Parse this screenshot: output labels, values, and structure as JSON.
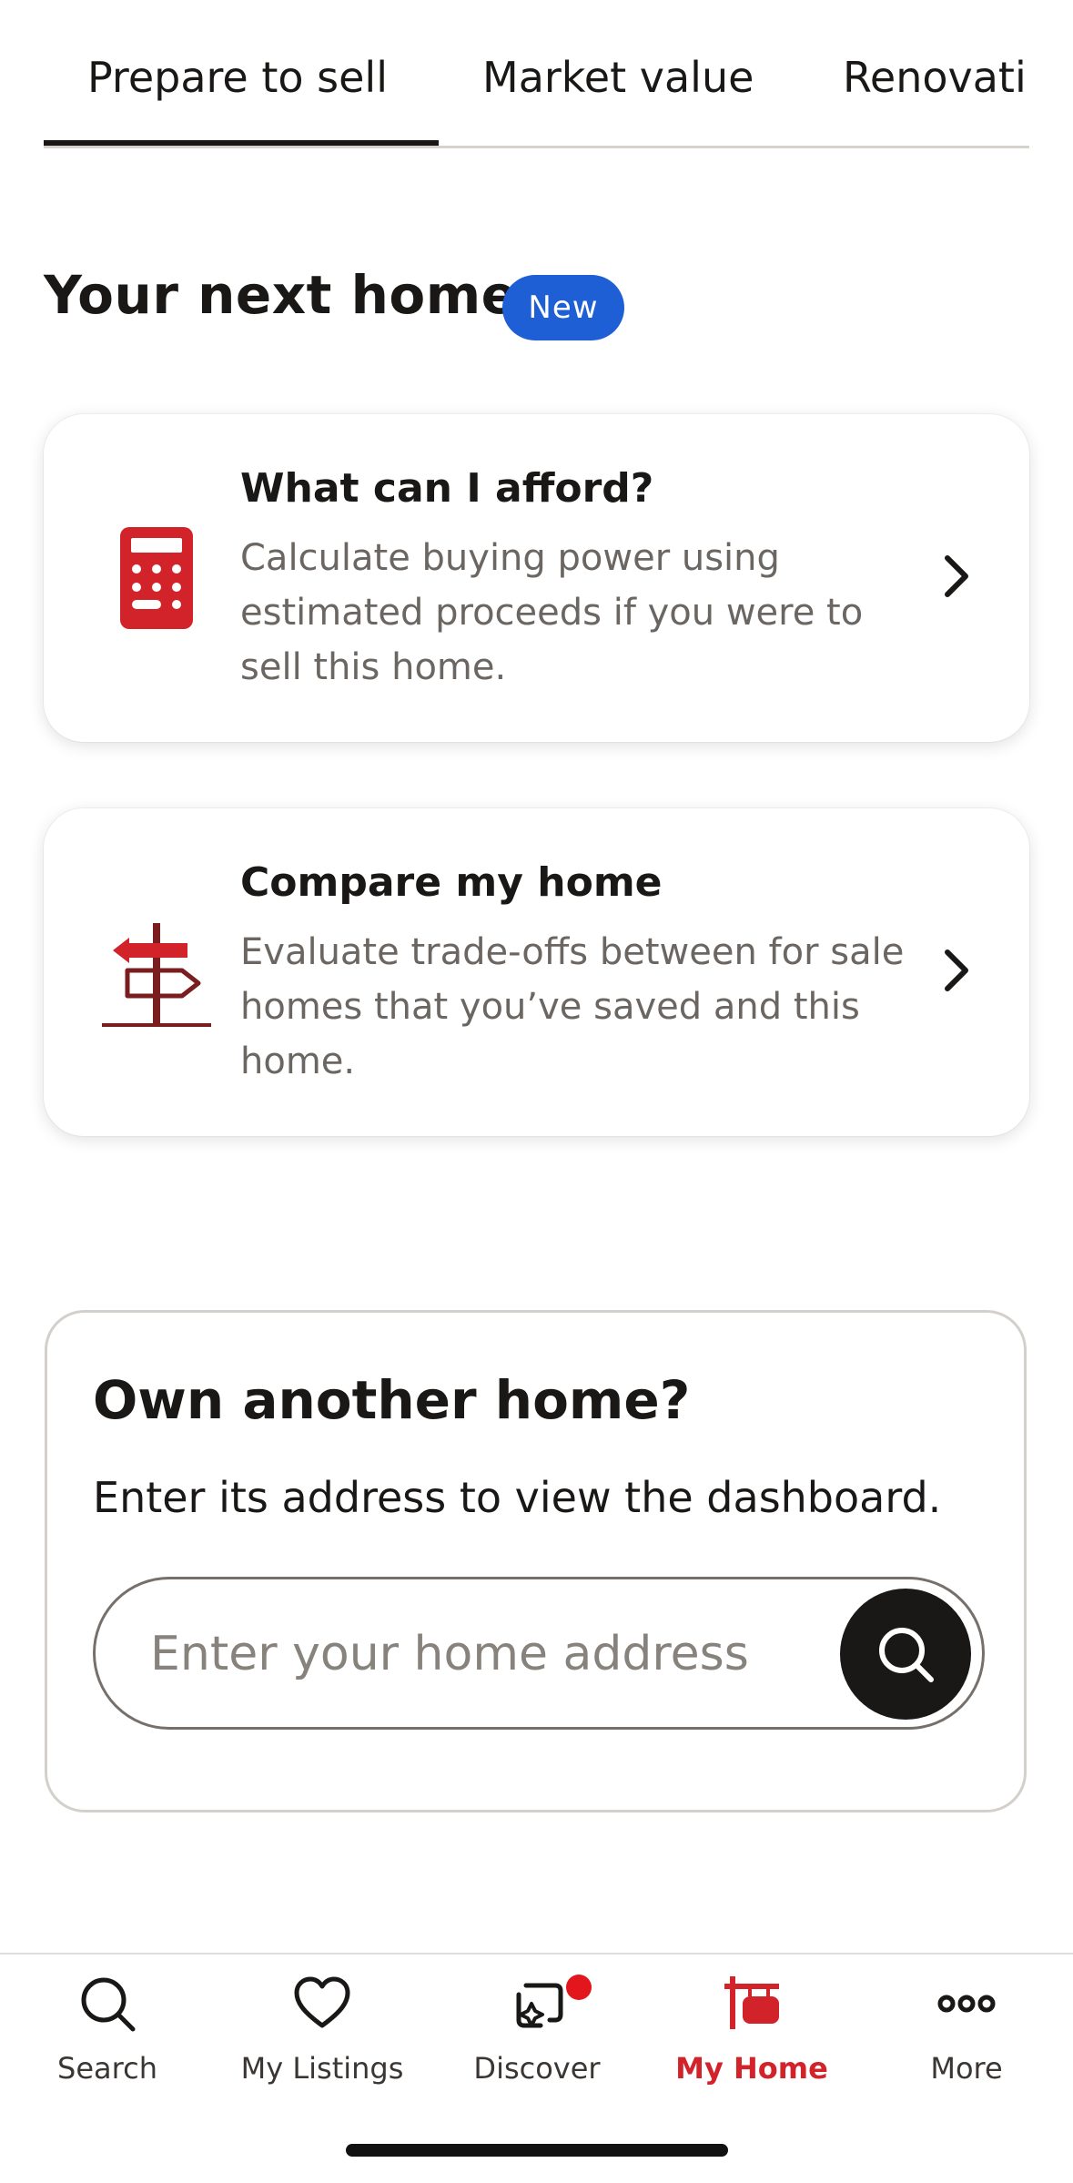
{
  "tabs": {
    "items": [
      "Prepare to sell",
      "Market value",
      "Renovati"
    ],
    "active_index": 0
  },
  "section": {
    "title": "Your next home",
    "badge": "New"
  },
  "cards": [
    {
      "title": "What can I afford?",
      "description": "Calculate buying power using estimated proceeds if you were to sell this home.",
      "icon": "calculator-icon"
    },
    {
      "title": "Compare my home",
      "description": "Evaluate trade-offs between for sale homes that you’ve saved and this home.",
      "icon": "signpost-icon"
    }
  ],
  "own_home": {
    "title": "Own another home?",
    "description": "Enter its address to view the dashboard.",
    "input_value": "",
    "input_placeholder": "Enter your home address"
  },
  "bottom_nav": {
    "items": [
      {
        "label": "Search",
        "icon": "search-icon"
      },
      {
        "label": "My Listings",
        "icon": "heart-icon"
      },
      {
        "label": "Discover",
        "icon": "discover-icon",
        "notification": true
      },
      {
        "label": "My Home",
        "icon": "home-sign-icon",
        "active": true
      },
      {
        "label": "More",
        "icon": "more-icon"
      }
    ]
  },
  "colors": {
    "accent_red": "#d2232a",
    "badge_blue": "#1f5fd6",
    "dark": "#1a1816",
    "muted_text": "#6b6661"
  }
}
